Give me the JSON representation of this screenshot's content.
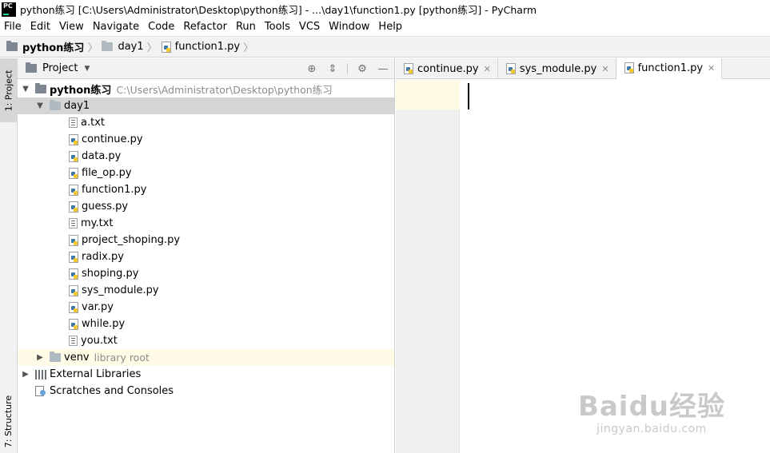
{
  "window": {
    "title": "python练习 [C:\\Users\\Administrator\\Desktop\\python练习] - ...\\day1\\function1.py [python练习] - PyCharm",
    "app_icon_text": "PC"
  },
  "menu": [
    "File",
    "Edit",
    "View",
    "Navigate",
    "Code",
    "Refactor",
    "Run",
    "Tools",
    "VCS",
    "Window",
    "Help"
  ],
  "breadcrumb": {
    "project": "python练习",
    "folder": "day1",
    "file": "function1.py"
  },
  "left_strip": {
    "project_tab": "1: Project",
    "structure_tab": "7: Structure"
  },
  "project_panel": {
    "title": "Project",
    "tree": {
      "root_name": "python练习",
      "root_path": "C:\\Users\\Administrator\\Desktop\\python练习",
      "day1": "day1",
      "files": [
        {
          "name": "a.txt",
          "icon": "txt-file-icon"
        },
        {
          "name": "continue.py",
          "icon": "python-file-icon"
        },
        {
          "name": "data.py",
          "icon": "python-file-icon"
        },
        {
          "name": "file_op.py",
          "icon": "python-file-icon"
        },
        {
          "name": "function1.py",
          "icon": "python-file-icon"
        },
        {
          "name": "guess.py",
          "icon": "python-file-icon"
        },
        {
          "name": "my.txt",
          "icon": "txt-file-icon"
        },
        {
          "name": "project_shoping.py",
          "icon": "python-file-icon"
        },
        {
          "name": "radix.py",
          "icon": "python-file-icon"
        },
        {
          "name": "shoping.py",
          "icon": "python-file-icon"
        },
        {
          "name": "sys_module.py",
          "icon": "python-file-icon"
        },
        {
          "name": "var.py",
          "icon": "python-file-icon"
        },
        {
          "name": "while.py",
          "icon": "python-file-icon"
        },
        {
          "name": "you.txt",
          "icon": "txt-file-icon"
        }
      ],
      "venv": "venv",
      "venv_note": "library root",
      "external_libraries": "External Libraries",
      "scratches": "Scratches and Consoles"
    }
  },
  "editor": {
    "tabs": [
      {
        "label": "continue.py",
        "active": false
      },
      {
        "label": "sys_module.py",
        "active": false
      },
      {
        "label": "function1.py",
        "active": true
      }
    ]
  },
  "watermark": {
    "brand": "Baidu经验",
    "url": "jingyan.baidu.com"
  },
  "colors": {
    "selected_row": "#d5d5d5",
    "venv_row": "#fffbe6",
    "gutter_current_line": "#fffae3",
    "python_blue": "#3c78aa",
    "python_yellow": "#f2c82e"
  }
}
